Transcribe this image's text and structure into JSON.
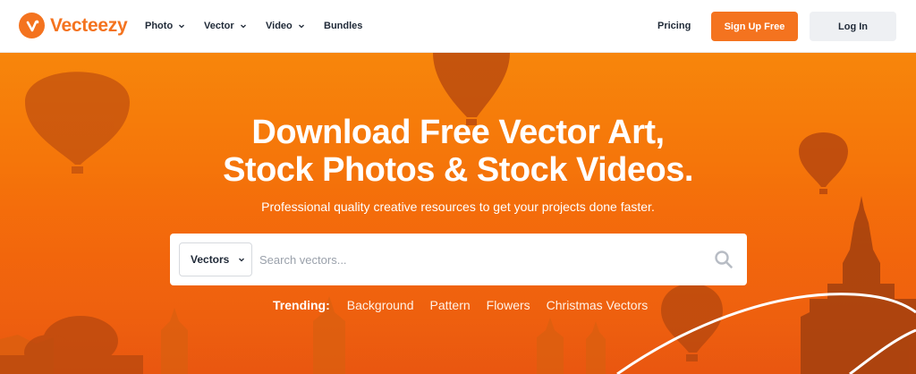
{
  "brand": {
    "name": "Vecteezy",
    "color": "#f4731f",
    "logo_icon": "vecteezy-v-logo"
  },
  "nav": {
    "items": [
      {
        "label": "Photo",
        "has_dropdown": true
      },
      {
        "label": "Vector",
        "has_dropdown": true
      },
      {
        "label": "Video",
        "has_dropdown": true
      },
      {
        "label": "Bundles",
        "has_dropdown": false
      }
    ],
    "pricing": "Pricing",
    "signup": "Sign Up Free",
    "login": "Log In"
  },
  "hero": {
    "title_line1": "Download Free Vector Art,",
    "title_line2": "Stock Photos & Stock Videos.",
    "subtitle": "Professional quality creative resources to get your projects done faster.",
    "background_colors": [
      "#f7860b",
      "#ee5a10"
    ]
  },
  "search": {
    "selected_type": "Vectors",
    "placeholder": "Search vectors...",
    "value": "",
    "icon": "search-icon"
  },
  "trending": {
    "label": "Trending:",
    "links": [
      "Background",
      "Pattern",
      "Flowers",
      "Christmas Vectors"
    ]
  }
}
